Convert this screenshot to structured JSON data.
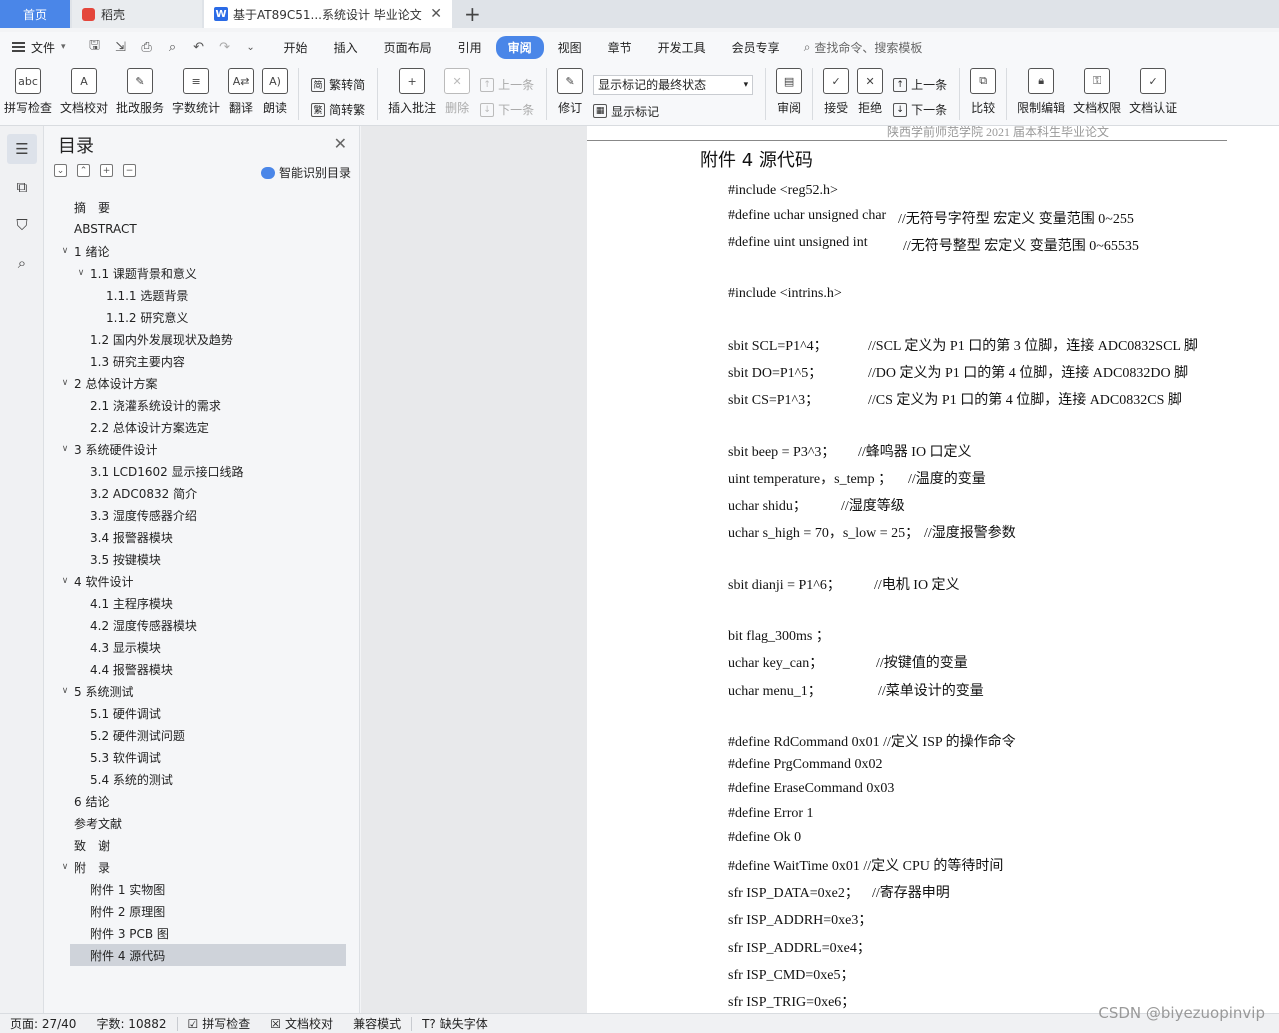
{
  "tabs": {
    "home": "首页",
    "daoke": "稻壳",
    "doc": "基于AT89C51...系统设计 毕业论文",
    "plus": "+"
  },
  "menu": {
    "file": "文件",
    "tabs": [
      "开始",
      "插入",
      "页面布局",
      "引用",
      "审阅",
      "视图",
      "章节",
      "开发工具",
      "会员专享"
    ],
    "active_tab": "审阅",
    "search": "查找命令、搜索模板"
  },
  "ribbon": {
    "spell": "拼写检查",
    "proof": "文档校对",
    "batch": "批改服务",
    "wordcount": "字数统计",
    "translate": "翻译",
    "read": "朗读",
    "trad": "繁转简",
    "simp": "简转繁",
    "insert_comment": "插入批注",
    "delete": "删除",
    "prev": "上一条",
    "next": "下一条",
    "revise": "修订",
    "markup_dropdown": "显示标记的最终状态",
    "show_markup": "显示标记",
    "review": "审阅",
    "accept": "接受",
    "reject": "拒绝",
    "prev2": "上一条",
    "next2": "下一条",
    "compare": "比较",
    "restrict": "限制编辑",
    "rights": "文档权限",
    "certify": "文档认证"
  },
  "toc": {
    "title": "目录",
    "smart": "智能识别目录",
    "items": [
      {
        "text": "摘　要",
        "level": 0,
        "chev": ""
      },
      {
        "text": "ABSTRACT",
        "level": 0,
        "chev": ""
      },
      {
        "text": "1  绪论",
        "level": 0,
        "chev": "v"
      },
      {
        "text": "1.1  课题背景和意义",
        "level": 1,
        "chev": "v"
      },
      {
        "text": "1.1.1 选题背景",
        "level": 2,
        "chev": ""
      },
      {
        "text": "1.1.2 研究意义",
        "level": 2,
        "chev": ""
      },
      {
        "text": "1.2  国内外发展现状及趋势",
        "level": 1,
        "chev": ""
      },
      {
        "text": "1.3 研究主要内容",
        "level": 1,
        "chev": ""
      },
      {
        "text": "2  总体设计方案",
        "level": 0,
        "chev": "v"
      },
      {
        "text": "2.1  浇灌系统设计的需求",
        "level": 1,
        "chev": ""
      },
      {
        "text": "2.2  总体设计方案选定",
        "level": 1,
        "chev": ""
      },
      {
        "text": "3  系统硬件设计",
        "level": 0,
        "chev": "v"
      },
      {
        "text": "3.1 LCD1602 显示接口线路",
        "level": 1,
        "chev": ""
      },
      {
        "text": "3.2 ADC0832 简介",
        "level": 1,
        "chev": ""
      },
      {
        "text": "3.3  湿度传感器介绍",
        "level": 1,
        "chev": ""
      },
      {
        "text": "3.4  报警器模块",
        "level": 1,
        "chev": ""
      },
      {
        "text": "3.5  按键模块",
        "level": 1,
        "chev": ""
      },
      {
        "text": "4  软件设计",
        "level": 0,
        "chev": "v"
      },
      {
        "text": "4.1  主程序模块",
        "level": 1,
        "chev": ""
      },
      {
        "text": "4.2  湿度传感器模块",
        "level": 1,
        "chev": ""
      },
      {
        "text": "4.3  显示模块",
        "level": 1,
        "chev": ""
      },
      {
        "text": "4.4  报警器模块",
        "level": 1,
        "chev": ""
      },
      {
        "text": "5  系统测试",
        "level": 0,
        "chev": "v"
      },
      {
        "text": "5.1  硬件调试",
        "level": 1,
        "chev": ""
      },
      {
        "text": "5.2  硬件测试问题",
        "level": 1,
        "chev": ""
      },
      {
        "text": "5.3  软件调试",
        "level": 1,
        "chev": ""
      },
      {
        "text": "5.4  系统的测试",
        "level": 1,
        "chev": ""
      },
      {
        "text": "6  结论",
        "level": 0,
        "chev": ""
      },
      {
        "text": "参考文献",
        "level": 0,
        "chev": ""
      },
      {
        "text": "致　谢",
        "level": 0,
        "chev": ""
      },
      {
        "text": "附　录",
        "level": 0,
        "chev": "v"
      },
      {
        "text": "附件 1  实物图",
        "level": 1,
        "chev": ""
      },
      {
        "text": "附件 2  原理图",
        "level": 1,
        "chev": ""
      },
      {
        "text": "附件 3  PCB 图",
        "level": 1,
        "chev": ""
      },
      {
        "text": "附件 4  源代码",
        "level": 1,
        "chev": "",
        "selected": true
      }
    ]
  },
  "document": {
    "header_text": "陕西学前师范学院 2021 届本科生毕业论文",
    "heading": "附件 4  源代码",
    "lines": [
      {
        "code": "#include <reg52.h>",
        "comment": ""
      },
      {
        "code": "#define uchar unsigned char",
        "comment": "//无符号字符型  宏定义      变量范围 0~255"
      },
      {
        "code": "#define uint    unsigned int",
        "comment": "//无符号整型  宏定义  变量范围 0~65535"
      },
      {
        "code": "",
        "comment": ""
      },
      {
        "code": "#include <intrins.h>",
        "comment": ""
      },
      {
        "code": "",
        "comment": ""
      },
      {
        "code": "sbit SCL=P1^4；",
        "comment": "//SCL 定义为 P1 口的第 3 位脚，连接 ADC0832SCL 脚"
      },
      {
        "code": "sbit DO=P1^5；",
        "comment": "//DO 定义为 P1 口的第 4 位脚，连接 ADC0832DO 脚"
      },
      {
        "code": "sbit CS=P1^3；",
        "comment": "//CS 定义为 P1 口的第 4 位脚，连接 ADC0832CS 脚"
      },
      {
        "code": "",
        "comment": ""
      },
      {
        "code": "sbit beep = P3^3；",
        "comment": "//蜂鸣器 IO 口定义"
      },
      {
        "code": "uint temperature，s_temp  ；",
        "comment": "//温度的变量"
      },
      {
        "code": "uchar shidu；",
        "comment": "//湿度等级"
      },
      {
        "code": "uchar s_high = 70，s_low = 25；",
        "comment": "//湿度报警参数"
      },
      {
        "code": "",
        "comment": ""
      },
      {
        "code": "sbit dianji = P1^6；",
        "comment": "//电机 IO 定义"
      },
      {
        "code": "",
        "comment": ""
      },
      {
        "code": "bit flag_300ms  ；",
        "comment": ""
      },
      {
        "code": "uchar key_can；",
        "comment": "//按键值的变量"
      },
      {
        "code": "uchar menu_1；",
        "comment": "//菜单设计的变量"
      },
      {
        "code": "",
        "comment": ""
      },
      {
        "code": "#define RdCommand 0x01 //定义 ISP 的操作命令",
        "comment": ""
      },
      {
        "code": "#define PrgCommand 0x02",
        "comment": ""
      },
      {
        "code": "#define EraseCommand 0x03",
        "comment": ""
      },
      {
        "code": "#define Error 1",
        "comment": ""
      },
      {
        "code": "#define Ok 0",
        "comment": ""
      },
      {
        "code": "#define WaitTime 0x01 //定义 CPU 的等待时间",
        "comment": ""
      },
      {
        "code": "sfr ISP_DATA=0xe2；",
        "comment": "//寄存器申明"
      },
      {
        "code": "sfr ISP_ADDRH=0xe3；",
        "comment": ""
      },
      {
        "code": "sfr ISP_ADDRL=0xe4；",
        "comment": ""
      },
      {
        "code": "sfr ISP_CMD=0xe5；",
        "comment": ""
      },
      {
        "code": "sfr ISP_TRIG=0xe6；",
        "comment": ""
      }
    ]
  },
  "status": {
    "page": "页面: 27/40",
    "words": "字数: 10882",
    "spell": "拼写检查",
    "proof": "文档校对",
    "compat": "兼容模式",
    "missing_font": "缺失字体"
  },
  "watermark": "CSDN @biyezuopinvip"
}
